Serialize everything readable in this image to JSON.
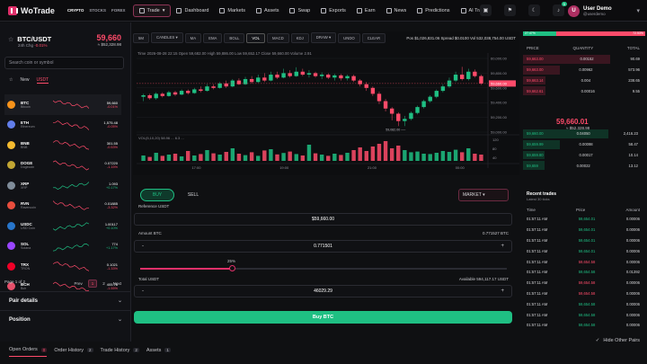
{
  "app": {
    "name": "WoTrade",
    "market_tabs": [
      "CRYPTO",
      "STOCKS",
      "FOREX"
    ],
    "nav": [
      {
        "label": "Trade"
      },
      {
        "label": "Dashboard"
      },
      {
        "label": "Markets"
      },
      {
        "label": "Assets"
      },
      {
        "label": "Swap"
      },
      {
        "label": "Exports"
      },
      {
        "label": "Earn"
      },
      {
        "label": "News"
      },
      {
        "label": "Predictions"
      },
      {
        "label": "AI Trade"
      }
    ],
    "notif_count": "5",
    "user": {
      "name": "User Demo",
      "handle": "@userdemo",
      "initial": "U"
    }
  },
  "pair": {
    "symbol": "BTC/USDT",
    "change_label": "24h Chg",
    "change": "-0.01%",
    "price": "59,660",
    "price_usd": "≈ $52,328.98"
  },
  "search": {
    "placeholder": "Search coin or symbol"
  },
  "filters": [
    "New",
    "USDT"
  ],
  "coins": [
    {
      "sym": "BTC",
      "name": "Bitcoin",
      "price": "59,660",
      "chg": "-0.01%",
      "up": false,
      "color": "#f7931a"
    },
    {
      "sym": "ETH",
      "name": "Ethereum",
      "price": "1,575.48",
      "chg": "-0.05%",
      "up": false,
      "color": "#627eea"
    },
    {
      "sym": "BNB",
      "name": "BNB",
      "price": "301.55",
      "chg": "-0.53%",
      "up": false,
      "color": "#f3ba2f"
    },
    {
      "sym": "DOGE",
      "name": "Dogecoin",
      "price": "0.07220",
      "chg": "-1.15%",
      "up": false,
      "color": "#c2a633"
    },
    {
      "sym": "XRP",
      "name": "XRP",
      "price": "1.093",
      "chg": "+0.17%",
      "up": true,
      "color": "#7f8c99"
    },
    {
      "sym": "RVN",
      "name": "Ravencoin",
      "price": "0.01885",
      "chg": "-3.32%",
      "up": false,
      "color": "#e84d3d"
    },
    {
      "sym": "USDC",
      "name": "USD Coin",
      "price": "1.00117",
      "chg": "+0.10%",
      "up": true,
      "color": "#2775ca"
    },
    {
      "sym": "SOL",
      "name": "Solana",
      "price": "774",
      "chg": "+1.17%",
      "up": true,
      "color": "#9945ff"
    },
    {
      "sym": "TRX",
      "name": "TRON",
      "price": "0.1021",
      "chg": "-1.33%",
      "up": false,
      "color": "#ef0027"
    },
    {
      "sym": "BCH",
      "name": "Bch",
      "price": "405.78",
      "chg": "-1.55%",
      "up": false,
      "color": "#e54f6a"
    }
  ],
  "pagination": {
    "label": "Page 1 of 2",
    "prev": "Prev",
    "pages": [
      "1",
      "2"
    ],
    "next": "Next"
  },
  "accordions": {
    "pair_details": "Pair details",
    "position": "Position"
  },
  "chart": {
    "toolbar": [
      "5M",
      "CANDLES ▾",
      "MA",
      "EMA",
      "BOLL",
      "VOL",
      "MACD",
      "KDJ",
      "DRAW ▾",
      "UNDO",
      "CLEAR"
    ],
    "info": "Pos $1,026,831.06   Spread $0.0100   Vol 532,038,754.00 USDT",
    "ohlc": "Time 2026-08-28 22:15   Open 59,682.00   High 59,886.00   Low 59,652.17   Close 59,660.00   Volume 2.91",
    "vol_label": "VOL(5,10,20) 58.96 ... 6.3 ...",
    "price_axis": [
      "60,000.00",
      "59,800.00",
      "59,600.00",
      "59,400.00",
      "59,200.00",
      "59,000.00"
    ],
    "vol_axis": [
      "120",
      "80",
      "40"
    ],
    "time_axis": [
      "17:00",
      "19:00",
      "21:00",
      "00:00"
    ],
    "last_tag": "59,660.00",
    "low_tag": "59,082.00 ──",
    "high_tag": "59,886.00",
    "title": "",
    "xlabel": "",
    "ylabel": ""
  },
  "chart_data": {
    "type": "candlestick",
    "x": [
      "17:00",
      "19:00",
      "21:00",
      "00:00"
    ],
    "ylim": [
      59000,
      60000
    ],
    "candles": [
      [
        59480,
        59500,
        59420,
        59520
      ],
      [
        59500,
        59460,
        59440,
        59520
      ],
      [
        59460,
        59520,
        59440,
        59540
      ],
      [
        59520,
        59490,
        59470,
        59540
      ],
      [
        59490,
        59540,
        59480,
        59560
      ],
      [
        59540,
        59510,
        59490,
        59560
      ],
      [
        59510,
        59560,
        59500,
        59580
      ],
      [
        59560,
        59530,
        59510,
        59580
      ],
      [
        59530,
        59580,
        59520,
        59600
      ],
      [
        59580,
        59560,
        59540,
        59620
      ],
      [
        59560,
        59620,
        59550,
        59650
      ],
      [
        59620,
        59600,
        59580,
        59650
      ],
      [
        59600,
        59660,
        59590,
        59680
      ],
      [
        59660,
        59620,
        59600,
        59700
      ],
      [
        59620,
        59700,
        59610,
        59720
      ],
      [
        59700,
        59650,
        59640,
        59730
      ],
      [
        59650,
        59720,
        59640,
        59750
      ],
      [
        59720,
        59680,
        59660,
        59760
      ],
      [
        59680,
        59740,
        59670,
        59780
      ],
      [
        59740,
        59700,
        59680,
        59800
      ],
      [
        59700,
        59780,
        59690,
        59820
      ],
      [
        59780,
        59740,
        59720,
        59820
      ],
      [
        59740,
        59800,
        59730,
        59860
      ],
      [
        59800,
        59760,
        59740,
        59840
      ],
      [
        59760,
        59820,
        59750,
        59880
      ],
      [
        59820,
        59780,
        59760,
        59860
      ],
      [
        59780,
        59800,
        59740,
        59840
      ],
      [
        59800,
        59760,
        59740,
        59820
      ],
      [
        59760,
        59780,
        59720,
        59810
      ],
      [
        59780,
        59740,
        59720,
        59800
      ],
      [
        59740,
        59770,
        59700,
        59790
      ],
      [
        59770,
        59730,
        59700,
        59790
      ],
      [
        59730,
        59760,
        59700,
        59780
      ],
      [
        59760,
        59700,
        59680,
        59780
      ],
      [
        59700,
        59650,
        59620,
        59720
      ],
      [
        59650,
        59600,
        59560,
        59680
      ],
      [
        59600,
        59520,
        59490,
        59620
      ],
      [
        59520,
        59420,
        59380,
        59550
      ],
      [
        59420,
        59320,
        59280,
        59450
      ],
      [
        59320,
        59250,
        59160,
        59340
      ],
      [
        59250,
        59150,
        59082,
        59270
      ],
      [
        59150,
        59180,
        59082,
        59220
      ],
      [
        59180,
        59260,
        59160,
        59280
      ],
      [
        59260,
        59340,
        59240,
        59360
      ],
      [
        59340,
        59420,
        59320,
        59440
      ],
      [
        59420,
        59480,
        59400,
        59500
      ],
      [
        59480,
        59560,
        59460,
        59580
      ],
      [
        59560,
        59620,
        59540,
        59650
      ],
      [
        59620,
        59700,
        59600,
        59740
      ],
      [
        59700,
        59780,
        59680,
        59820
      ],
      [
        59780,
        59720,
        59700,
        59886
      ],
      [
        59720,
        59820,
        59700,
        59860
      ],
      [
        59820,
        59760,
        59740,
        59850
      ],
      [
        59760,
        59660,
        59640,
        59780
      ]
    ],
    "volumes": [
      30,
      22,
      45,
      28,
      35,
      40,
      25,
      55,
      30,
      38,
      60,
      42,
      35,
      50,
      70,
      40,
      32,
      48,
      28,
      58,
      65,
      36,
      44,
      52,
      38,
      30,
      90,
      42,
      35,
      28,
      40,
      33,
      45,
      60,
      75,
      55,
      80,
      95,
      110,
      70,
      85,
      60,
      48,
      52,
      40,
      38,
      45,
      55,
      50,
      62,
      48,
      70,
      40,
      35
    ]
  },
  "order": {
    "tabs": [
      "BUY",
      "SELL"
    ],
    "type": "MARKET ▾",
    "ref_label": "Reference USDT",
    "ref_value": "$59,660.00",
    "amount_label": "Amount BTC",
    "amount_value": "0.771501",
    "amount_hint": "0.771527 BTC",
    "slider_pct": "25%",
    "slider_value": 0.25,
    "total_label": "Total USDT",
    "available": "Available  594,117.17 USDT",
    "total_value": "46029.29",
    "buy_label": "Buy BTC"
  },
  "orderbook": {
    "buy_pct": "27.47%",
    "sell_pct": "72.53%",
    "headers": [
      "PRICE",
      "QUANTITY",
      "TOTAL"
    ],
    "asks": [
      [
        "59,663.00",
        "0.00152",
        "90.69"
      ],
      [
        "59,663.00",
        "0.00962",
        "573.96"
      ],
      [
        "59,663.14",
        "0.004",
        "238.65"
      ],
      [
        "59,662.61",
        "0.00016",
        "9.55"
      ]
    ],
    "mid_price": "59,660.01",
    "mid_usd": "≈ $52,328.98",
    "bids": [
      [
        "59,660.00",
        "0.04050",
        "2,416.23"
      ],
      [
        "59,659.99",
        "0.00098",
        "58.47"
      ],
      [
        "59,659.80",
        "0.00017",
        "10.14"
      ],
      [
        "59,659",
        "0.00022",
        "13.12"
      ]
    ]
  },
  "trades": {
    "title": "Recent trades",
    "subtitle": "Latest 30 ticks",
    "headers": [
      "Time",
      "Price",
      "Amount"
    ],
    "rows": [
      [
        "01:57:11 AM",
        "59,654.01",
        "0.00006",
        "up"
      ],
      [
        "01:57:11 AM",
        "59,654.01",
        "0.00006",
        "up"
      ],
      [
        "01:57:11 AM",
        "59,654.01",
        "0.00006",
        "up"
      ],
      [
        "01:57:11 AM",
        "59,654.01",
        "0.00006",
        "up"
      ],
      [
        "01:57:11 AM",
        "59,654.58",
        "0.00006",
        "down"
      ],
      [
        "01:57:11 AM",
        "59,654.58",
        "0.01392",
        "up"
      ],
      [
        "01:57:11 AM",
        "59,654.58",
        "0.00006",
        "down"
      ],
      [
        "01:57:11 AM",
        "59,654.58",
        "0.00006",
        "down"
      ],
      [
        "01:57:11 AM",
        "59,654.58",
        "0.00006",
        "up"
      ],
      [
        "01:57:11 AM",
        "59,654.58",
        "0.00006",
        "up"
      ],
      [
        "01:57:11 AM",
        "59,654.58",
        "0.00006",
        "up"
      ]
    ]
  },
  "bottom": {
    "tabs": [
      {
        "label": "Open Orders",
        "count": "0"
      },
      {
        "label": "Order History",
        "count": "2"
      },
      {
        "label": "Trade History",
        "count": "2"
      },
      {
        "label": "Assets",
        "count": "1"
      }
    ],
    "hide_label": "Hide Other Pairs"
  },
  "colors": {
    "up": "#1fbf83",
    "down": "#ff4b6a",
    "accent": "#e0306a"
  }
}
